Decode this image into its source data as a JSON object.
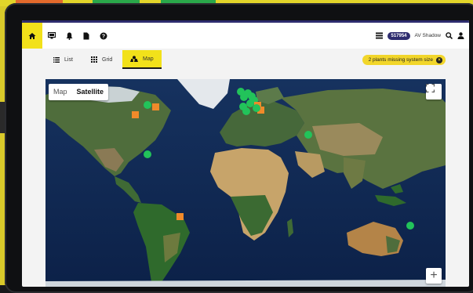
{
  "header": {
    "plant_badge": "517954",
    "user_name": "AV Shadow"
  },
  "tabs": [
    {
      "label": "List",
      "icon": "list-icon"
    },
    {
      "label": "Grid",
      "icon": "grid-icon"
    },
    {
      "label": "Map",
      "icon": "map-icon",
      "active": true
    }
  ],
  "warning": {
    "text": "2 plants missing system size"
  },
  "map": {
    "type_options": [
      "Map",
      "Satellite"
    ],
    "selected_type": "Satellite",
    "zoom_in_label": "+",
    "markers": [
      {
        "lat": 44,
        "lon": -78,
        "kind": "circle"
      },
      {
        "lat": 43,
        "lon": -71,
        "kind": "square"
      },
      {
        "lat": 38,
        "lon": -88,
        "kind": "square"
      },
      {
        "lat": 12,
        "lon": -78,
        "kind": "circle"
      },
      {
        "lat": -28,
        "lon": -51,
        "kind": "square"
      },
      {
        "lat": 53,
        "lon": -1,
        "kind": "circle"
      },
      {
        "lat": 52,
        "lon": 5,
        "kind": "circle"
      },
      {
        "lat": 50,
        "lon": 8,
        "kind": "circle"
      },
      {
        "lat": 49,
        "lon": 2,
        "kind": "circle"
      },
      {
        "lat": 47,
        "lon": 10,
        "kind": "circle"
      },
      {
        "lat": 45,
        "lon": 7,
        "kind": "circle"
      },
      {
        "lat": 43,
        "lon": 1,
        "kind": "circle"
      },
      {
        "lat": 44,
        "lon": 13,
        "kind": "square"
      },
      {
        "lat": 41,
        "lon": 16,
        "kind": "square"
      },
      {
        "lat": 42,
        "lon": 12,
        "kind": "circle"
      },
      {
        "lat": 40,
        "lon": 4,
        "kind": "circle"
      },
      {
        "lat": 25,
        "lon": 55,
        "kind": "circle"
      },
      {
        "lat": -34,
        "lon": 139,
        "kind": "circle"
      }
    ]
  },
  "colors": {
    "accent_yellow": "#f2e11a",
    "navy": "#2e2c6f",
    "marker_green": "#22c35a",
    "marker_orange": "#f08a2a"
  }
}
